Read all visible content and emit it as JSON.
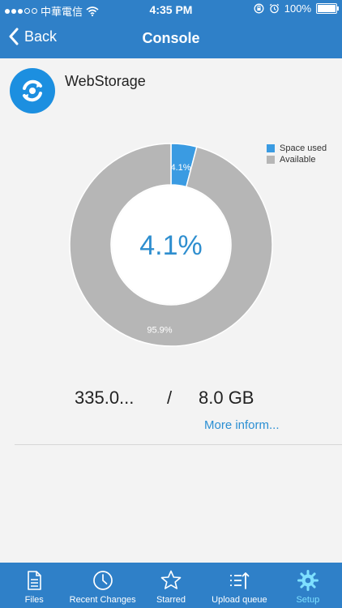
{
  "status": {
    "carrier": "中華電信",
    "time": "4:35 PM",
    "battery": "100%"
  },
  "nav": {
    "back_label": "Back",
    "title": "Console"
  },
  "app": {
    "name": "WebStorage"
  },
  "chart_data": {
    "type": "pie",
    "variant": "donut",
    "categories": [
      "Space used",
      "Available"
    ],
    "values": [
      4.1,
      95.9
    ],
    "slice_labels": [
      "4.1%",
      "95.9%"
    ],
    "center_label": "4.1%",
    "colors": [
      "#3a9be2",
      "#b6b6b6"
    ],
    "legend_position": "top-right",
    "title": ""
  },
  "storage": {
    "used": "335.0...",
    "separator": "/",
    "total": "8.0 GB",
    "more_info": "More inform..."
  },
  "tabs": [
    {
      "label": "Files",
      "icon": "file-icon"
    },
    {
      "label": "Recent Changes",
      "icon": "clock-icon"
    },
    {
      "label": "Starred",
      "icon": "star-icon"
    },
    {
      "label": "Upload queue",
      "icon": "upload-queue-icon"
    },
    {
      "label": "Setup",
      "icon": "gear-icon",
      "active": true
    }
  ],
  "colors": {
    "header": "#2f80c8",
    "accent": "#2b8fd3",
    "active_tab": "#7ee0ff"
  }
}
